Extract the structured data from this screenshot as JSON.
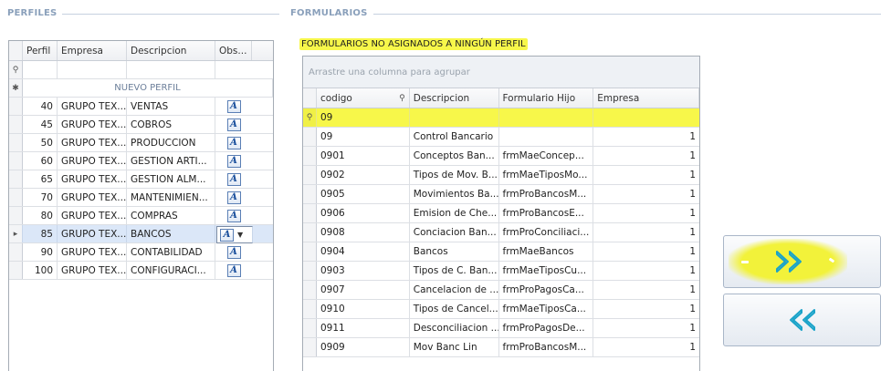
{
  "perfiles": {
    "title": "PERFILES",
    "columns": [
      "Perfil",
      "Empresa",
      "Descripcion",
      "Obs..."
    ],
    "new_row_label": "NUEVO PERFIL",
    "rows": [
      {
        "perfil": "40",
        "empresa": "GRUPO TEX...",
        "descripcion": "VENTAS"
      },
      {
        "perfil": "45",
        "empresa": "GRUPO TEX...",
        "descripcion": "COBROS"
      },
      {
        "perfil": "50",
        "empresa": "GRUPO TEX...",
        "descripcion": "PRODUCCION"
      },
      {
        "perfil": "60",
        "empresa": "GRUPO TEX...",
        "descripcion": "GESTION ARTI..."
      },
      {
        "perfil": "65",
        "empresa": "GRUPO TEX...",
        "descripcion": "GESTION ALM..."
      },
      {
        "perfil": "70",
        "empresa": "GRUPO TEX...",
        "descripcion": "MANTENIMIEN..."
      },
      {
        "perfil": "80",
        "empresa": "GRUPO TEX...",
        "descripcion": "COMPRAS"
      },
      {
        "perfil": "85",
        "empresa": "GRUPO TEX...",
        "descripcion": "BANCOS"
      },
      {
        "perfil": "90",
        "empresa": "GRUPO TEX...",
        "descripcion": "CONTABILIDAD"
      },
      {
        "perfil": "100",
        "empresa": "GRUPO TEX...",
        "descripcion": "CONFIGURACI..."
      }
    ],
    "selected_perfil": "85"
  },
  "formularios": {
    "title": "FORMULARIOS",
    "subtitle": "FORMULARIOS NO ASIGNADOS A NINGÚN PERFIL",
    "group_panel_hint": "Arrastre una columna para agrupar",
    "columns": [
      "codigo",
      "Descripcion",
      "Formulario Hijo",
      "Empresa"
    ],
    "filter_value": "09",
    "rows": [
      {
        "codigo": "09",
        "descripcion": "Control Bancario",
        "hijo": "",
        "empresa": "1"
      },
      {
        "codigo": "0901",
        "descripcion": "Conceptos Ban...",
        "hijo": "frmMaeConcep...",
        "empresa": "1"
      },
      {
        "codigo": "0902",
        "descripcion": "Tipos de Mov. B...",
        "hijo": "frmMaeTiposMo...",
        "empresa": "1"
      },
      {
        "codigo": "0905",
        "descripcion": "Movimientos Ba...",
        "hijo": "frmProBancosM...",
        "empresa": "1"
      },
      {
        "codigo": "0906",
        "descripcion": "Emision de Che...",
        "hijo": "frmProBancosE...",
        "empresa": "1"
      },
      {
        "codigo": "0908",
        "descripcion": "Conciacion Ban...",
        "hijo": "frmProConciliaci...",
        "empresa": "1"
      },
      {
        "codigo": "0904",
        "descripcion": "Bancos",
        "hijo": "frmMaeBancos",
        "empresa": "1"
      },
      {
        "codigo": "0903",
        "descripcion": "Tipos de C. Ban...",
        "hijo": "frmMaeTiposCu...",
        "empresa": "1"
      },
      {
        "codigo": "0907",
        "descripcion": "Cancelacion de ...",
        "hijo": "frmProPagosCa...",
        "empresa": "1"
      },
      {
        "codigo": "0910",
        "descripcion": "Tipos de Cancel...",
        "hijo": "frmMaeTiposCa...",
        "empresa": "1"
      },
      {
        "codigo": "0911",
        "descripcion": "Desconciliacion ...",
        "hijo": "frmProPagosDe...",
        "empresa": "1"
      },
      {
        "codigo": "0909",
        "descripcion": "Mov Banc Lin",
        "hijo": "frmProBancosM...",
        "empresa": "1"
      }
    ]
  },
  "colors": {
    "highlight": "#f7f74a",
    "accent_arrow": "#1aa3c9",
    "selected_row": "#dbe7f8"
  },
  "icons": {
    "add": "double-chevron-right-icon",
    "remove": "double-chevron-left-icon",
    "memo": "memo-edit-icon",
    "filter": "filter-icon",
    "new_row": "asterisk-icon",
    "current_row": "row-pointer-icon"
  }
}
